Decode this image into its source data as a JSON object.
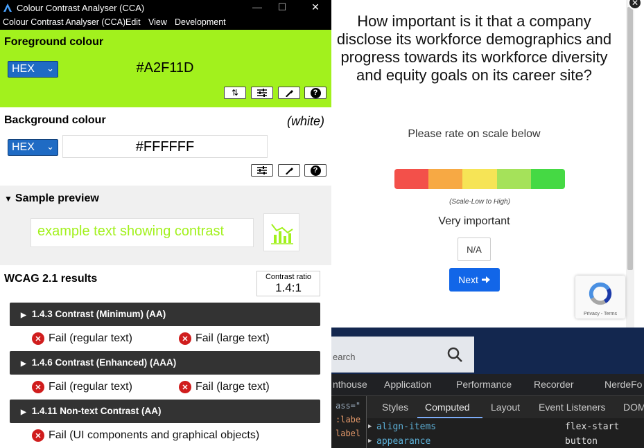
{
  "survey": {
    "question": "How important is it that a company disclose its workforce demographics and progress towards its workforce diversity and equity goals on its career site?",
    "instruction": "Please rate on scale below",
    "scale_colors": [
      "#f3504a",
      "#f7a944",
      "#f6e456",
      "#a5e25a",
      "#45d944"
    ],
    "scale_caption": "(Scale-Low to High)",
    "selected_label": "Very important",
    "na_label": "N/A",
    "next_label": "Next",
    "next_icon": "arrow-right-icon",
    "recaptcha_text": "Privacy - Terms"
  },
  "background_page": {
    "search_placeholder": "earch"
  },
  "devtools": {
    "main_tabs": [
      "nthouse",
      "Application",
      "Performance",
      "Recorder",
      "NerdeFo"
    ],
    "sub_tabs": [
      "Styles",
      "Computed",
      "Layout",
      "Event Listeners",
      "DOM"
    ],
    "active_sub_tab": "Computed",
    "left_snippets": [
      "ass=\"",
      ":labe",
      "label"
    ],
    "computed_rows": [
      {
        "property": "align-items",
        "value": "flex-start"
      },
      {
        "property": "appearance",
        "value": "button"
      }
    ]
  },
  "cca": {
    "window_title": "Colour Contrast Analyser (CCA)",
    "menu": [
      "Colour Contrast Analyser (CCA)",
      "Edit",
      "View",
      "Development"
    ],
    "foreground": {
      "title": "Foreground colour",
      "format": "HEX",
      "value": "#A2F11D",
      "color": "#A2F11D"
    },
    "background": {
      "title": "Background colour",
      "note": "(white)",
      "format": "HEX",
      "value": "#FFFFFF"
    },
    "sample": {
      "title": "Sample preview",
      "text": "example text showing contrast"
    },
    "wcag": {
      "title": "WCAG 2.1 results",
      "ratio_label": "Contrast ratio",
      "ratio_value": "1.4:1",
      "criteria": [
        {
          "label": "1.4.3 Contrast (Minimum) (AA)",
          "results": [
            "Fail (regular text)",
            "Fail (large text)"
          ]
        },
        {
          "label": "1.4.6 Contrast (Enhanced) (AAA)",
          "results": [
            "Fail (regular text)",
            "Fail (large text)"
          ]
        },
        {
          "label": "1.4.11 Non-text Contrast (AA)",
          "results": [
            "Fail (UI components and graphical objects)"
          ]
        }
      ]
    }
  }
}
